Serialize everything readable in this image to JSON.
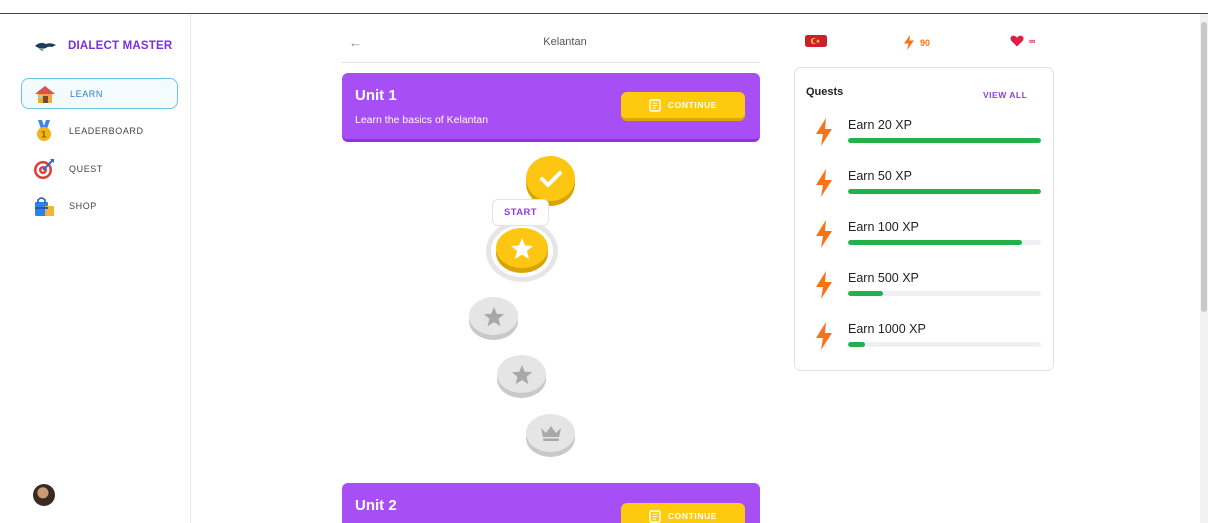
{
  "app": {
    "brand": "DIALECT MASTER"
  },
  "sidebar": {
    "items": [
      {
        "label": "LEARN",
        "icon": "house-icon",
        "active": true
      },
      {
        "label": "LEADERBOARD",
        "icon": "medal-icon",
        "active": false
      },
      {
        "label": "QUEST",
        "icon": "target-icon",
        "active": false
      },
      {
        "label": "SHOP",
        "icon": "shopping-bag-icon",
        "active": false
      }
    ]
  },
  "header": {
    "title": "Kelantan"
  },
  "units": [
    {
      "title": "Unit 1",
      "subtitle": "Learn the basics of Kelantan",
      "button": "CONTINUE"
    },
    {
      "title": "Unit 2",
      "subtitle": "",
      "button": "CONTINUE"
    }
  ],
  "path": {
    "start_label": "START",
    "nodes": [
      {
        "state": "done",
        "icon": "check-icon"
      },
      {
        "state": "current",
        "icon": "star-icon"
      },
      {
        "state": "locked",
        "icon": "star-icon"
      },
      {
        "state": "locked",
        "icon": "star-icon"
      },
      {
        "state": "locked",
        "icon": "crown-icon"
      }
    ]
  },
  "stats": {
    "flag_icon": "malaysia-flag-icon",
    "xp": "90",
    "hearts": "∞"
  },
  "quests": {
    "title": "Quests",
    "view_all": "VIEW ALL",
    "items": [
      {
        "label": "Earn 20 XP",
        "progress": 1.0
      },
      {
        "label": "Earn 50 XP",
        "progress": 1.0
      },
      {
        "label": "Earn 100 XP",
        "progress": 0.9
      },
      {
        "label": "Earn 500 XP",
        "progress": 0.18
      },
      {
        "label": "Earn 1000 XP",
        "progress": 0.09
      }
    ]
  },
  "colors": {
    "brand": "#7b2fe0",
    "unit": "#a84ef5",
    "button": "#fdca0e",
    "progress": "#22b14c",
    "xp": "#f97316",
    "heart": "#e11d48"
  }
}
